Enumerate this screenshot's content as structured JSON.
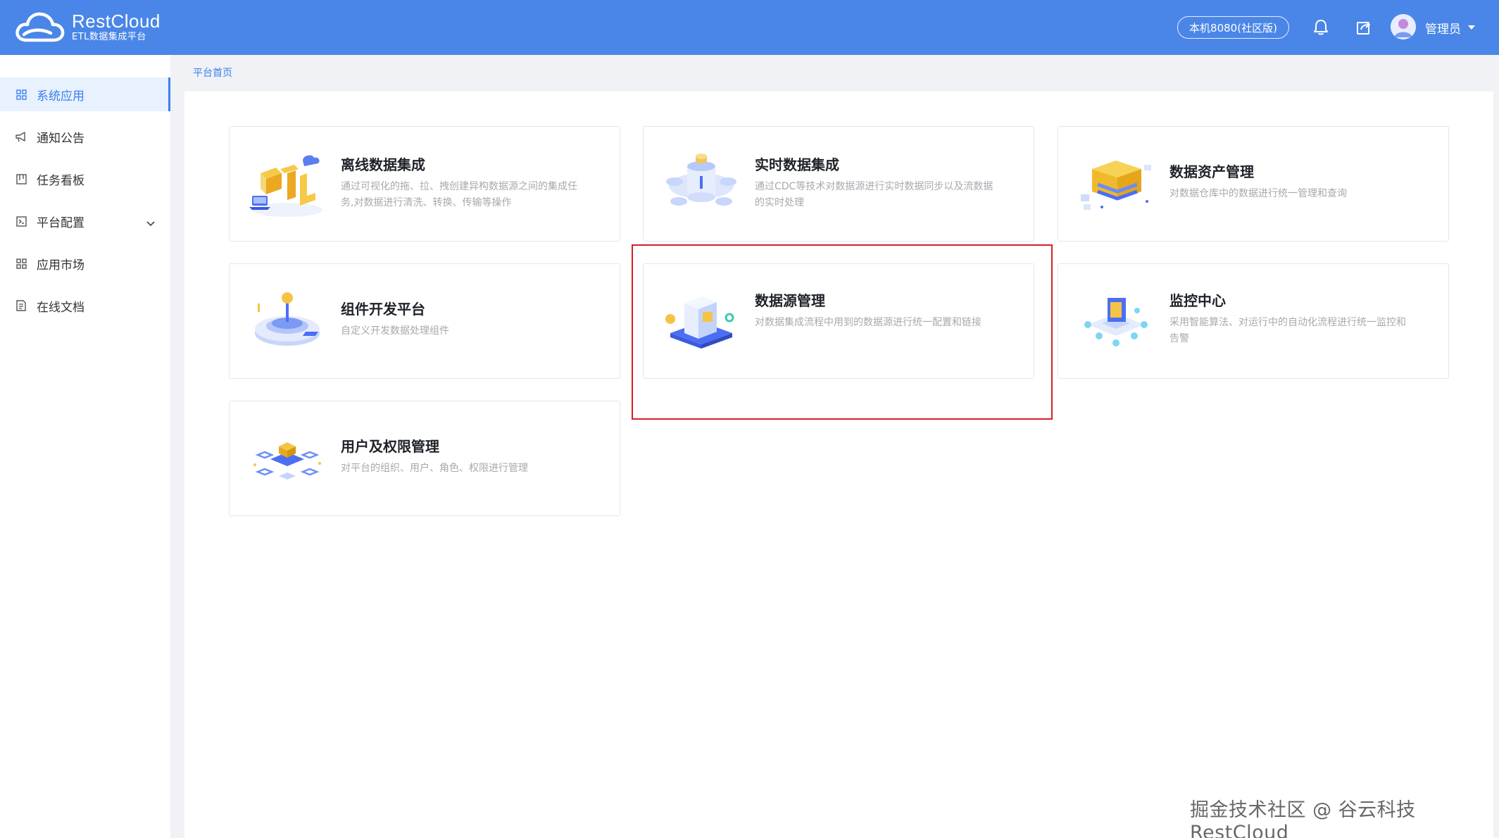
{
  "header": {
    "brand_title": "RestCloud",
    "brand_subtitle": "ETL数据集成平台",
    "env_label": "本机8080(社区版)",
    "user_name": "管理员",
    "bar_color": "#4a86e8"
  },
  "sidebar": {
    "items": [
      {
        "label": "系统应用",
        "icon": "grid-icon",
        "active": true
      },
      {
        "label": "通知公告",
        "icon": "megaphone-icon"
      },
      {
        "label": "任务看板",
        "icon": "kanban-icon"
      },
      {
        "label": "平台配置",
        "icon": "terminal-icon",
        "expandable": true
      },
      {
        "label": "应用市场",
        "icon": "grid-icon"
      },
      {
        "label": "在线文档",
        "icon": "document-icon"
      }
    ]
  },
  "breadcrumb": "平台首页",
  "cards": [
    {
      "title": "离线数据集成",
      "desc": "通过可视化的拖、拉、拽创建异构数据源之间的集成任务,对数据进行清洗、转换、传输等操作",
      "icon": "etl-illustration-icon"
    },
    {
      "title": "实时数据集成",
      "desc": "通过CDC等技术对数据源进行实时数据同步以及流数据的实时处理",
      "icon": "realtime-illustration-icon"
    },
    {
      "title": "数据资产管理",
      "desc": "对数据仓库中的数据进行统一管理和查询",
      "icon": "asset-illustration-icon"
    },
    {
      "title": "组件开发平台",
      "desc": "自定义开发数据处理组件",
      "icon": "component-illustration-icon"
    },
    {
      "title": "数据源管理",
      "desc": "对数据集成流程中用到的数据源进行统一配置和链接",
      "icon": "datasource-illustration-icon"
    },
    {
      "title": "监控中心",
      "desc": "采用智能算法、对运行中的自动化流程进行统一监控和告警",
      "icon": "monitor-illustration-icon"
    },
    {
      "title": "用户及权限管理",
      "desc": "对平台的组织、用户、角色、权限进行管理",
      "icon": "users-illustration-icon"
    }
  ],
  "watermark": "掘金技术社区 @ 谷云科技RestCloud",
  "accent_color": "#3c7ff0",
  "highlight_color": "#d81e28"
}
